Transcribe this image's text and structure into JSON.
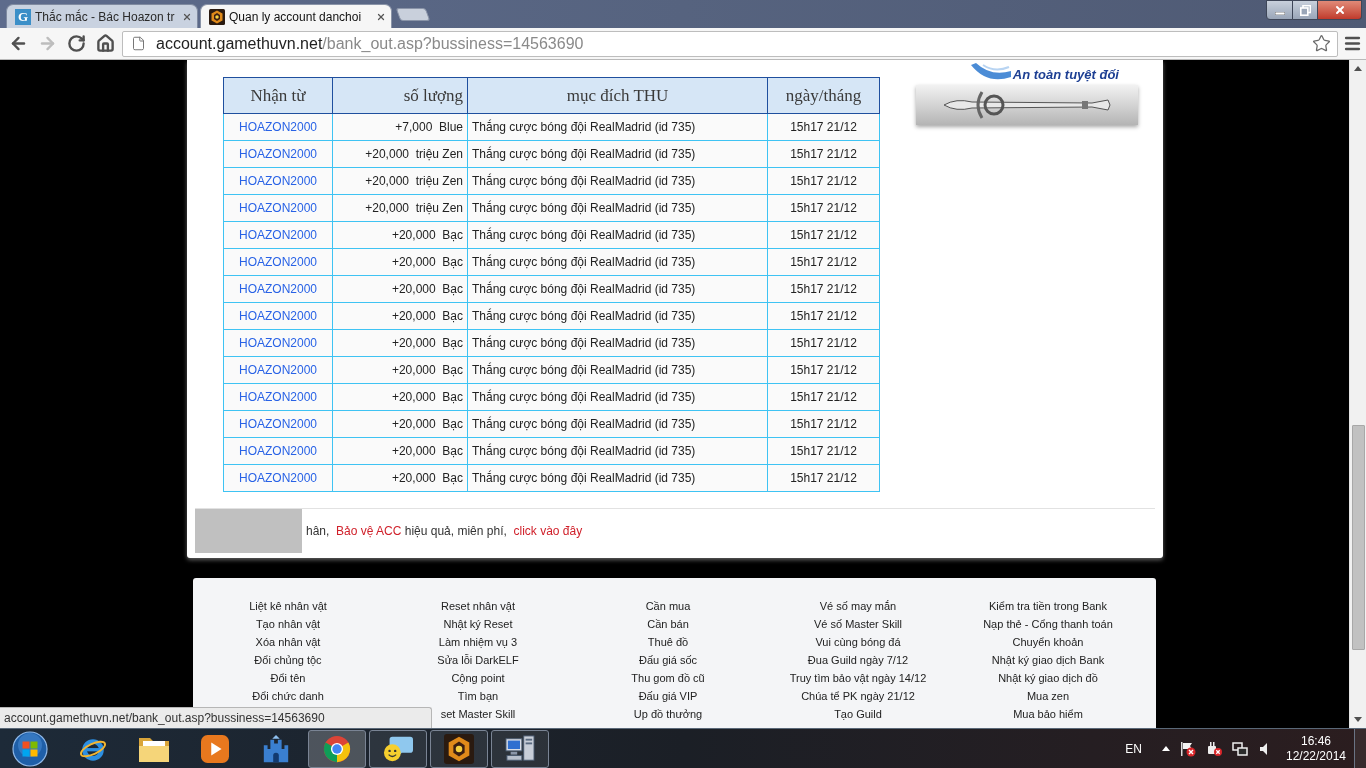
{
  "browser": {
    "tabs": [
      {
        "favicon": {
          "kind": "letter",
          "text": "G"
        },
        "title": "Thắc mắc - Bác Hoazon tr",
        "selected": false
      },
      {
        "favicon": {
          "kind": "emblem"
        },
        "title": "Quan ly account danchoi",
        "selected": true
      }
    ],
    "nav_buttons": [
      {
        "kind": "back",
        "disabled": false
      },
      {
        "kind": "forward",
        "disabled": true
      },
      {
        "kind": "reload",
        "disabled": false
      },
      {
        "kind": "home",
        "disabled": false
      }
    ],
    "address": {
      "host": "account.gamethuvn.net",
      "path": "/bank_out.asp?bussiness=14563690"
    }
  },
  "banner": {
    "caption": "An toàn tuyệt đối"
  },
  "table": {
    "columns": [
      "Nhận từ",
      "số lượng",
      "mục đích THU",
      "ngày/tháng"
    ],
    "rows": [
      {
        "from": "HOAZON2000",
        "amount": "+7,000  Blue",
        "purpose": "Thắng cược bóng đội RealMadrid (id 735)",
        "date": "15h17 21/12"
      },
      {
        "from": "HOAZON2000",
        "amount": "+20,000  triệu Zen",
        "purpose": "Thắng cược bóng đội RealMadrid (id 735)",
        "date": "15h17 21/12"
      },
      {
        "from": "HOAZON2000",
        "amount": "+20,000  triệu Zen",
        "purpose": "Thắng cược bóng đội RealMadrid (id 735)",
        "date": "15h17 21/12"
      },
      {
        "from": "HOAZON2000",
        "amount": "+20,000  triệu Zen",
        "purpose": "Thắng cược bóng đội RealMadrid (id 735)",
        "date": "15h17 21/12"
      },
      {
        "from": "HOAZON2000",
        "amount": "+20,000  Bạc",
        "purpose": "Thắng cược bóng đội RealMadrid (id 735)",
        "date": "15h17 21/12"
      },
      {
        "from": "HOAZON2000",
        "amount": "+20,000  Bạc",
        "purpose": "Thắng cược bóng đội RealMadrid (id 735)",
        "date": "15h17 21/12"
      },
      {
        "from": "HOAZON2000",
        "amount": "+20,000  Bạc",
        "purpose": "Thắng cược bóng đội RealMadrid (id 735)",
        "date": "15h17 21/12"
      },
      {
        "from": "HOAZON2000",
        "amount": "+20,000  Bạc",
        "purpose": "Thắng cược bóng đội RealMadrid (id 735)",
        "date": "15h17 21/12"
      },
      {
        "from": "HOAZON2000",
        "amount": "+20,000  Bạc",
        "purpose": "Thắng cược bóng đội RealMadrid (id 735)",
        "date": "15h17 21/12"
      },
      {
        "from": "HOAZON2000",
        "amount": "+20,000  Bạc",
        "purpose": "Thắng cược bóng đội RealMadrid (id 735)",
        "date": "15h17 21/12"
      },
      {
        "from": "HOAZON2000",
        "amount": "+20,000  Bạc",
        "purpose": "Thắng cược bóng đội RealMadrid (id 735)",
        "date": "15h17 21/12"
      },
      {
        "from": "HOAZON2000",
        "amount": "+20,000  Bạc",
        "purpose": "Thắng cược bóng đội RealMadrid (id 735)",
        "date": "15h17 21/12"
      },
      {
        "from": "HOAZON2000",
        "amount": "+20,000  Bạc",
        "purpose": "Thắng cược bóng đội RealMadrid (id 735)",
        "date": "15h17 21/12"
      },
      {
        "from": "HOAZON2000",
        "amount": "+20,000  Bạc",
        "purpose": "Thắng cược bóng đội RealMadrid (id 735)",
        "date": "15h17 21/12"
      }
    ]
  },
  "notice": {
    "lead": "hân,",
    "link": "Bảo vệ ACC",
    "text": "hiệu quả, miên phí,",
    "action": "click vào đây"
  },
  "footer": {
    "columns": [
      [
        "Liệt kê nhân vật",
        "Tạo nhân vật",
        "Xóa nhân vật",
        "Đổi chủng tộc",
        "Đổi tên",
        "Đổi chức danh"
      ],
      [
        "Reset nhân vật",
        "Nhật ký Reset",
        "Làm nhiệm vụ 3",
        "Sửa lỗi DarkELF",
        "Cộng point",
        "Tìm bạn",
        "set Master Skill"
      ],
      [
        "Cần mua",
        "Cần bán",
        "Thuê đồ",
        "Đấu giá sốc",
        "Thu gom đồ cũ",
        "Đấu giá VIP",
        "Up đồ thưởng"
      ],
      [
        "Vé số may mắn",
        "Vé số Master Skill",
        "Vui cùng bóng đá",
        "Đua Guild ngày 7/12",
        "Truy tìm bảo vật ngày 14/12",
        "Chúa tể PK ngày 21/12",
        "Tạo Guild"
      ],
      [
        "Kiểm tra tiền trong Bank",
        "Nạp thẻ - Cổng thanh toán",
        "Chuyển khoản",
        "Nhật ký giao dịch Bank",
        "Nhật ký giao dịch đồ",
        "Mua zen",
        "Mua bảo hiểm"
      ]
    ]
  },
  "status_bubble": {
    "url": "account.gamethuvn.net/bank_out.asp?bussiness=14563690"
  },
  "taskbar": {
    "apps": [
      {
        "kind": "ie",
        "running": false,
        "selected": false
      },
      {
        "kind": "folder",
        "running": false,
        "selected": false
      },
      {
        "kind": "media",
        "running": false,
        "selected": false
      },
      {
        "kind": "castle",
        "running": false,
        "selected": false
      },
      {
        "kind": "chrome",
        "running": true,
        "selected": true
      },
      {
        "kind": "chat",
        "running": true,
        "selected": false
      },
      {
        "kind": "game",
        "running": true,
        "selected": false
      },
      {
        "kind": "network",
        "running": true,
        "selected": false
      }
    ],
    "language": "EN",
    "time": "16:46",
    "date": "12/22/2014"
  }
}
